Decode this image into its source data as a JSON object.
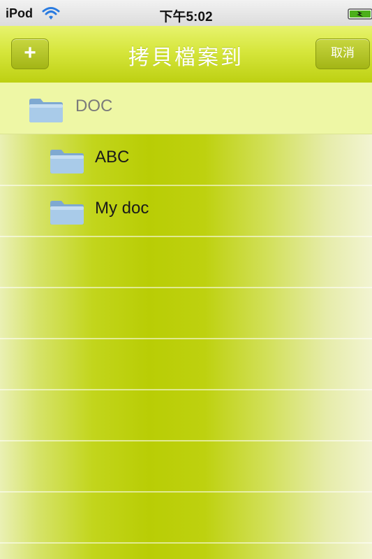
{
  "status_bar": {
    "carrier": "iPod",
    "time": "下午5:02"
  },
  "nav_bar": {
    "add_label": "+",
    "title": "拷貝檔案到",
    "cancel_label": "取消"
  },
  "current_folder": {
    "label": "DOC"
  },
  "folders": [
    {
      "label": "ABC"
    },
    {
      "label": "My doc"
    }
  ],
  "colors": {
    "nav_bar_green": "#cfe030",
    "current_row_bg": "#eef7a5",
    "list_center": "#b9cd05",
    "folder_blue": "#9cc3e6"
  }
}
